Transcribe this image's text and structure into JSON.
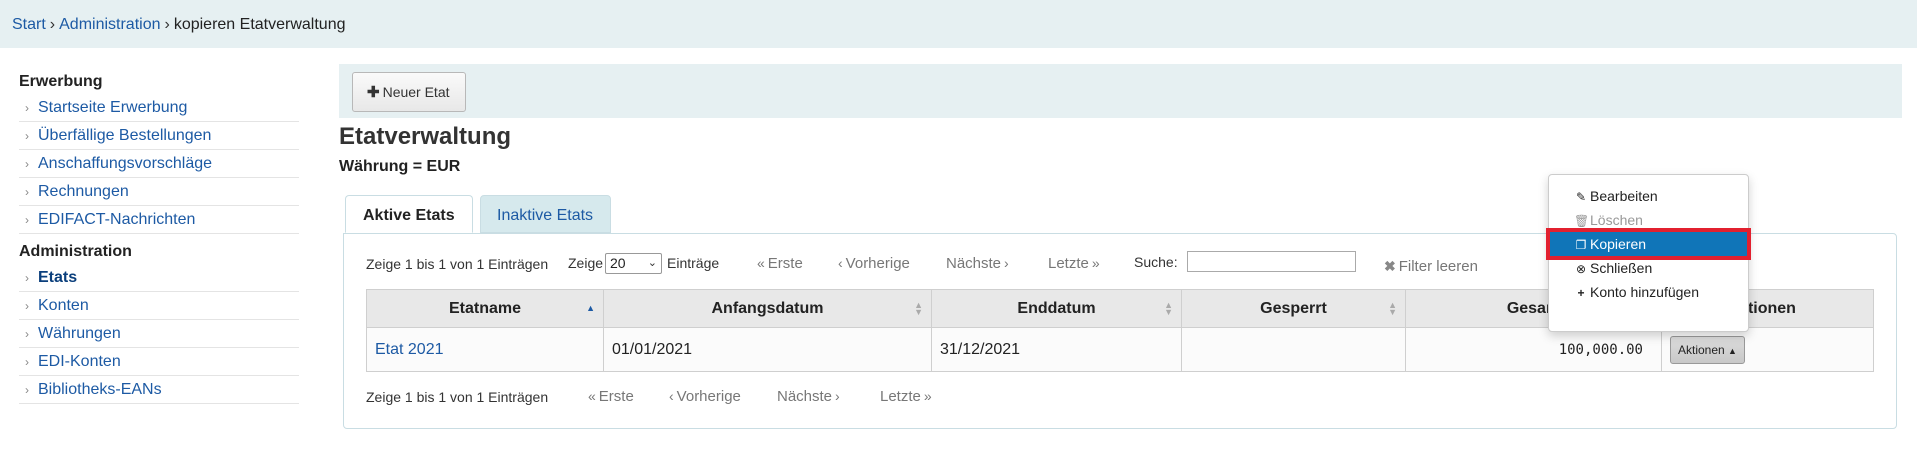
{
  "breadcrumb": {
    "start": "Start",
    "sep1": "›",
    "admin": "Administration",
    "sep2": "›",
    "current": "kopieren Etatverwaltung"
  },
  "sidebar": {
    "section1": "Erwerbung",
    "items1": [
      "Startseite Erwerbung",
      "Überfällige Bestellungen",
      "Anschaffungsvorschläge",
      "Rechnungen",
      "EDIFACT-Nachrichten"
    ],
    "section2": "Administration",
    "items2": [
      "Etats",
      "Konten",
      "Währungen",
      "EDI-Konten",
      "Bibliotheks-EANs"
    ],
    "chevron": "›"
  },
  "toolbar": {
    "new_budget": "Neuer Etat",
    "plus": "✚"
  },
  "page": {
    "title": "Etatverwaltung",
    "currency": "Währung = EUR"
  },
  "tabs": {
    "active": "Aktive Etats",
    "inactive": "Inaktive Etats"
  },
  "table_top": {
    "info": "Zeige 1 bis 1 von 1 Einträgen",
    "show_label": "Zeige",
    "page_length": "20",
    "entries_label": "Einträge",
    "first": "Erste",
    "previous": "Vorherige",
    "next": "Nächste",
    "last": "Letzte",
    "search_label": "Suche:",
    "clear_filter": "Filter leeren"
  },
  "table": {
    "columns": [
      "Etatname",
      "Anfangsdatum",
      "Enddatum",
      "Gesperrt",
      "Gesam",
      "ktionen"
    ],
    "row": {
      "name": "Etat 2021",
      "start": "01/01/2021",
      "end": "31/12/2021",
      "locked": "",
      "total": "100,000.00",
      "actions": "Aktionen"
    }
  },
  "table_bottom": {
    "info": "Zeige 1 bis 1 von 1 Einträgen",
    "first": "Erste",
    "previous": "Vorherige",
    "next": "Nächste",
    "last": "Letzte"
  },
  "dropdown": {
    "edit": "Bearbeiten",
    "delete": "Löschen",
    "copy": "Kopieren",
    "close": "Schließen",
    "add_fund": "Konto hinzufügen"
  },
  "colors": {
    "link": "#1d5aa4",
    "header_band": "#e6f0f2",
    "selected_item": "#1075b8",
    "highlight": "#e2202f"
  }
}
